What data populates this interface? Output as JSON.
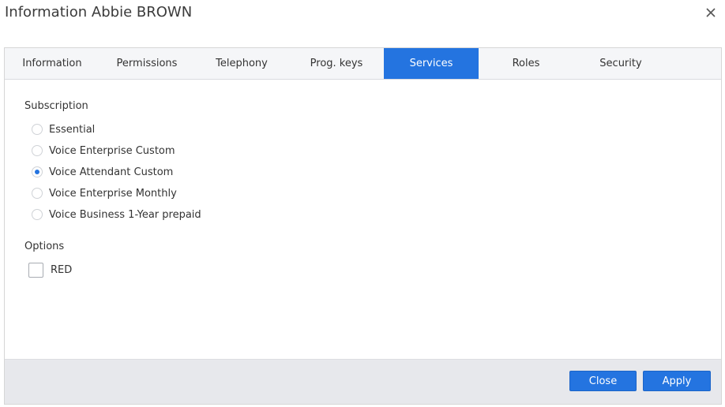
{
  "dialog": {
    "title": "Information Abbie BROWN",
    "close_icon": "close-icon"
  },
  "tabs": [
    {
      "label": "Information",
      "active": false
    },
    {
      "label": "Permissions",
      "active": false
    },
    {
      "label": "Telephony",
      "active": false
    },
    {
      "label": "Prog. keys",
      "active": false
    },
    {
      "label": "Services",
      "active": true
    },
    {
      "label": "Roles",
      "active": false
    },
    {
      "label": "Security",
      "active": false
    }
  ],
  "subscription": {
    "label": "Subscription",
    "options": [
      {
        "label": "Essential",
        "checked": false
      },
      {
        "label": "Voice Enterprise Custom",
        "checked": false
      },
      {
        "label": "Voice Attendant Custom",
        "checked": true
      },
      {
        "label": "Voice Enterprise Monthly",
        "checked": false
      },
      {
        "label": "Voice Business 1-Year prepaid",
        "checked": false
      }
    ]
  },
  "options": {
    "label": "Options",
    "items": [
      {
        "label": "RED",
        "checked": false
      }
    ]
  },
  "footer": {
    "close_label": "Close",
    "apply_label": "Apply"
  },
  "colors": {
    "accent": "#2474e0",
    "tab_bar_bg": "#f5f6f8",
    "footer_bg": "#e7e8ec"
  }
}
